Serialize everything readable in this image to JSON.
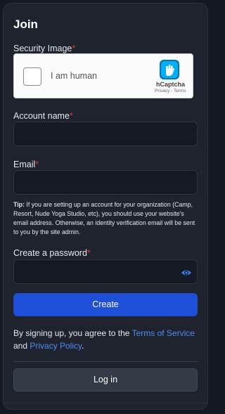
{
  "form": {
    "title": "Join",
    "security_label": "Security Image",
    "required_mark": "*",
    "captcha": {
      "text": "I am human",
      "brand": "hCaptcha",
      "privacy": "Privacy",
      "separator": " - ",
      "terms": "Terms"
    },
    "account_label": "Account name",
    "account_value": "",
    "email_label": "Email",
    "email_value": "",
    "tip_prefix": "Tip:",
    "tip_text": " If you are setting up an account for your organization (Camp, Resort, Nude Yoga Studio, etc), you should use your website's email address. Otherwise, an identity verification email will be sent to you by the site admin.",
    "password_label": "Create a password",
    "password_value": "",
    "create_button": "Create",
    "terms_prefix": "By signing up, you agree to the ",
    "terms_link": "Terms of Service",
    "terms_and": " and ",
    "privacy_link": "Privacy Policy",
    "terms_suffix": ".",
    "login_button": "Log in"
  },
  "colors": {
    "background": "#141820",
    "card": "#1e232d",
    "primary": "#1d4fd8",
    "link": "#4d8df5",
    "required": "#e0343c",
    "eye_icon": "#3b82f6"
  },
  "icons": {
    "captcha_logo": "hcaptcha-logo-icon",
    "password_toggle": "eye-icon"
  }
}
